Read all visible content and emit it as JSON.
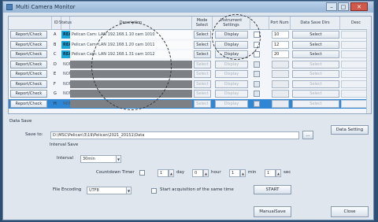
{
  "window": {
    "title": "Multi Camera Monitor",
    "controls": {
      "minimize": "–",
      "maximize": "□",
      "close": "✕"
    }
  },
  "grid": {
    "headers": {
      "id": "ID",
      "status": "Status",
      "description": "Description",
      "mode_select": "Mode Select",
      "instrument_settings": "Instrument Settings",
      "port_number": "Port Num",
      "save_dir": "Data Save Dirs",
      "note": "Desc"
    },
    "row_button_label": "Report/Check",
    "pick_label": "Select",
    "display_label": "Display",
    "save_label": "Select",
    "rows": [
      {
        "id": "A",
        "status": "READY",
        "description": "Pelican Cam: LAN 192.168.1.10 cam 1010",
        "port": "10"
      },
      {
        "id": "B",
        "status": "READY",
        "description": "Pelican Cam: LAN 192.168.1.20 cam 1011",
        "port": "12"
      },
      {
        "id": "C",
        "status": "READY",
        "description": "Pelican Cam: LAN 192.168.1.31 cam 1012",
        "port": "20"
      },
      {
        "id": "D",
        "status": "NONE",
        "description": "",
        "port": ""
      },
      {
        "id": "E",
        "status": "NONE",
        "description": "",
        "port": ""
      },
      {
        "id": "F",
        "status": "NONE",
        "description": "",
        "port": ""
      },
      {
        "id": "G",
        "status": "NONE",
        "description": "",
        "port": ""
      },
      {
        "id": "H",
        "status": "NONE",
        "description": "",
        "port": ""
      }
    ]
  },
  "data_save": {
    "section_title": "Data Save",
    "save_to_label": "Save to:",
    "save_to_value": "D:\\MSC\\Pelican\\3\\19\\Pelican\\2021_20151\\Data",
    "browse_label": "...",
    "data_setting_label": "Data Setting",
    "interval_save_label": "Interval Save",
    "interval_label": "Interval",
    "interval_value": "30min",
    "countdown_label": "Countdown Timer",
    "timer_days_value": "1",
    "timer_days_unit": "day",
    "timer_hours_value": "0",
    "timer_hours_unit": "hour",
    "timer_minutes_value": "1",
    "timer_minutes_unit": "min",
    "timer_seconds_value": "1",
    "timer_seconds_unit": "sec",
    "file_encoding_label": "File Encoding",
    "file_encoding_value": "UTF8",
    "start_all_label": "Start acquisition of the same time",
    "start_button": "START",
    "manual_save_button": "ManualSave",
    "close_button": "Close"
  }
}
